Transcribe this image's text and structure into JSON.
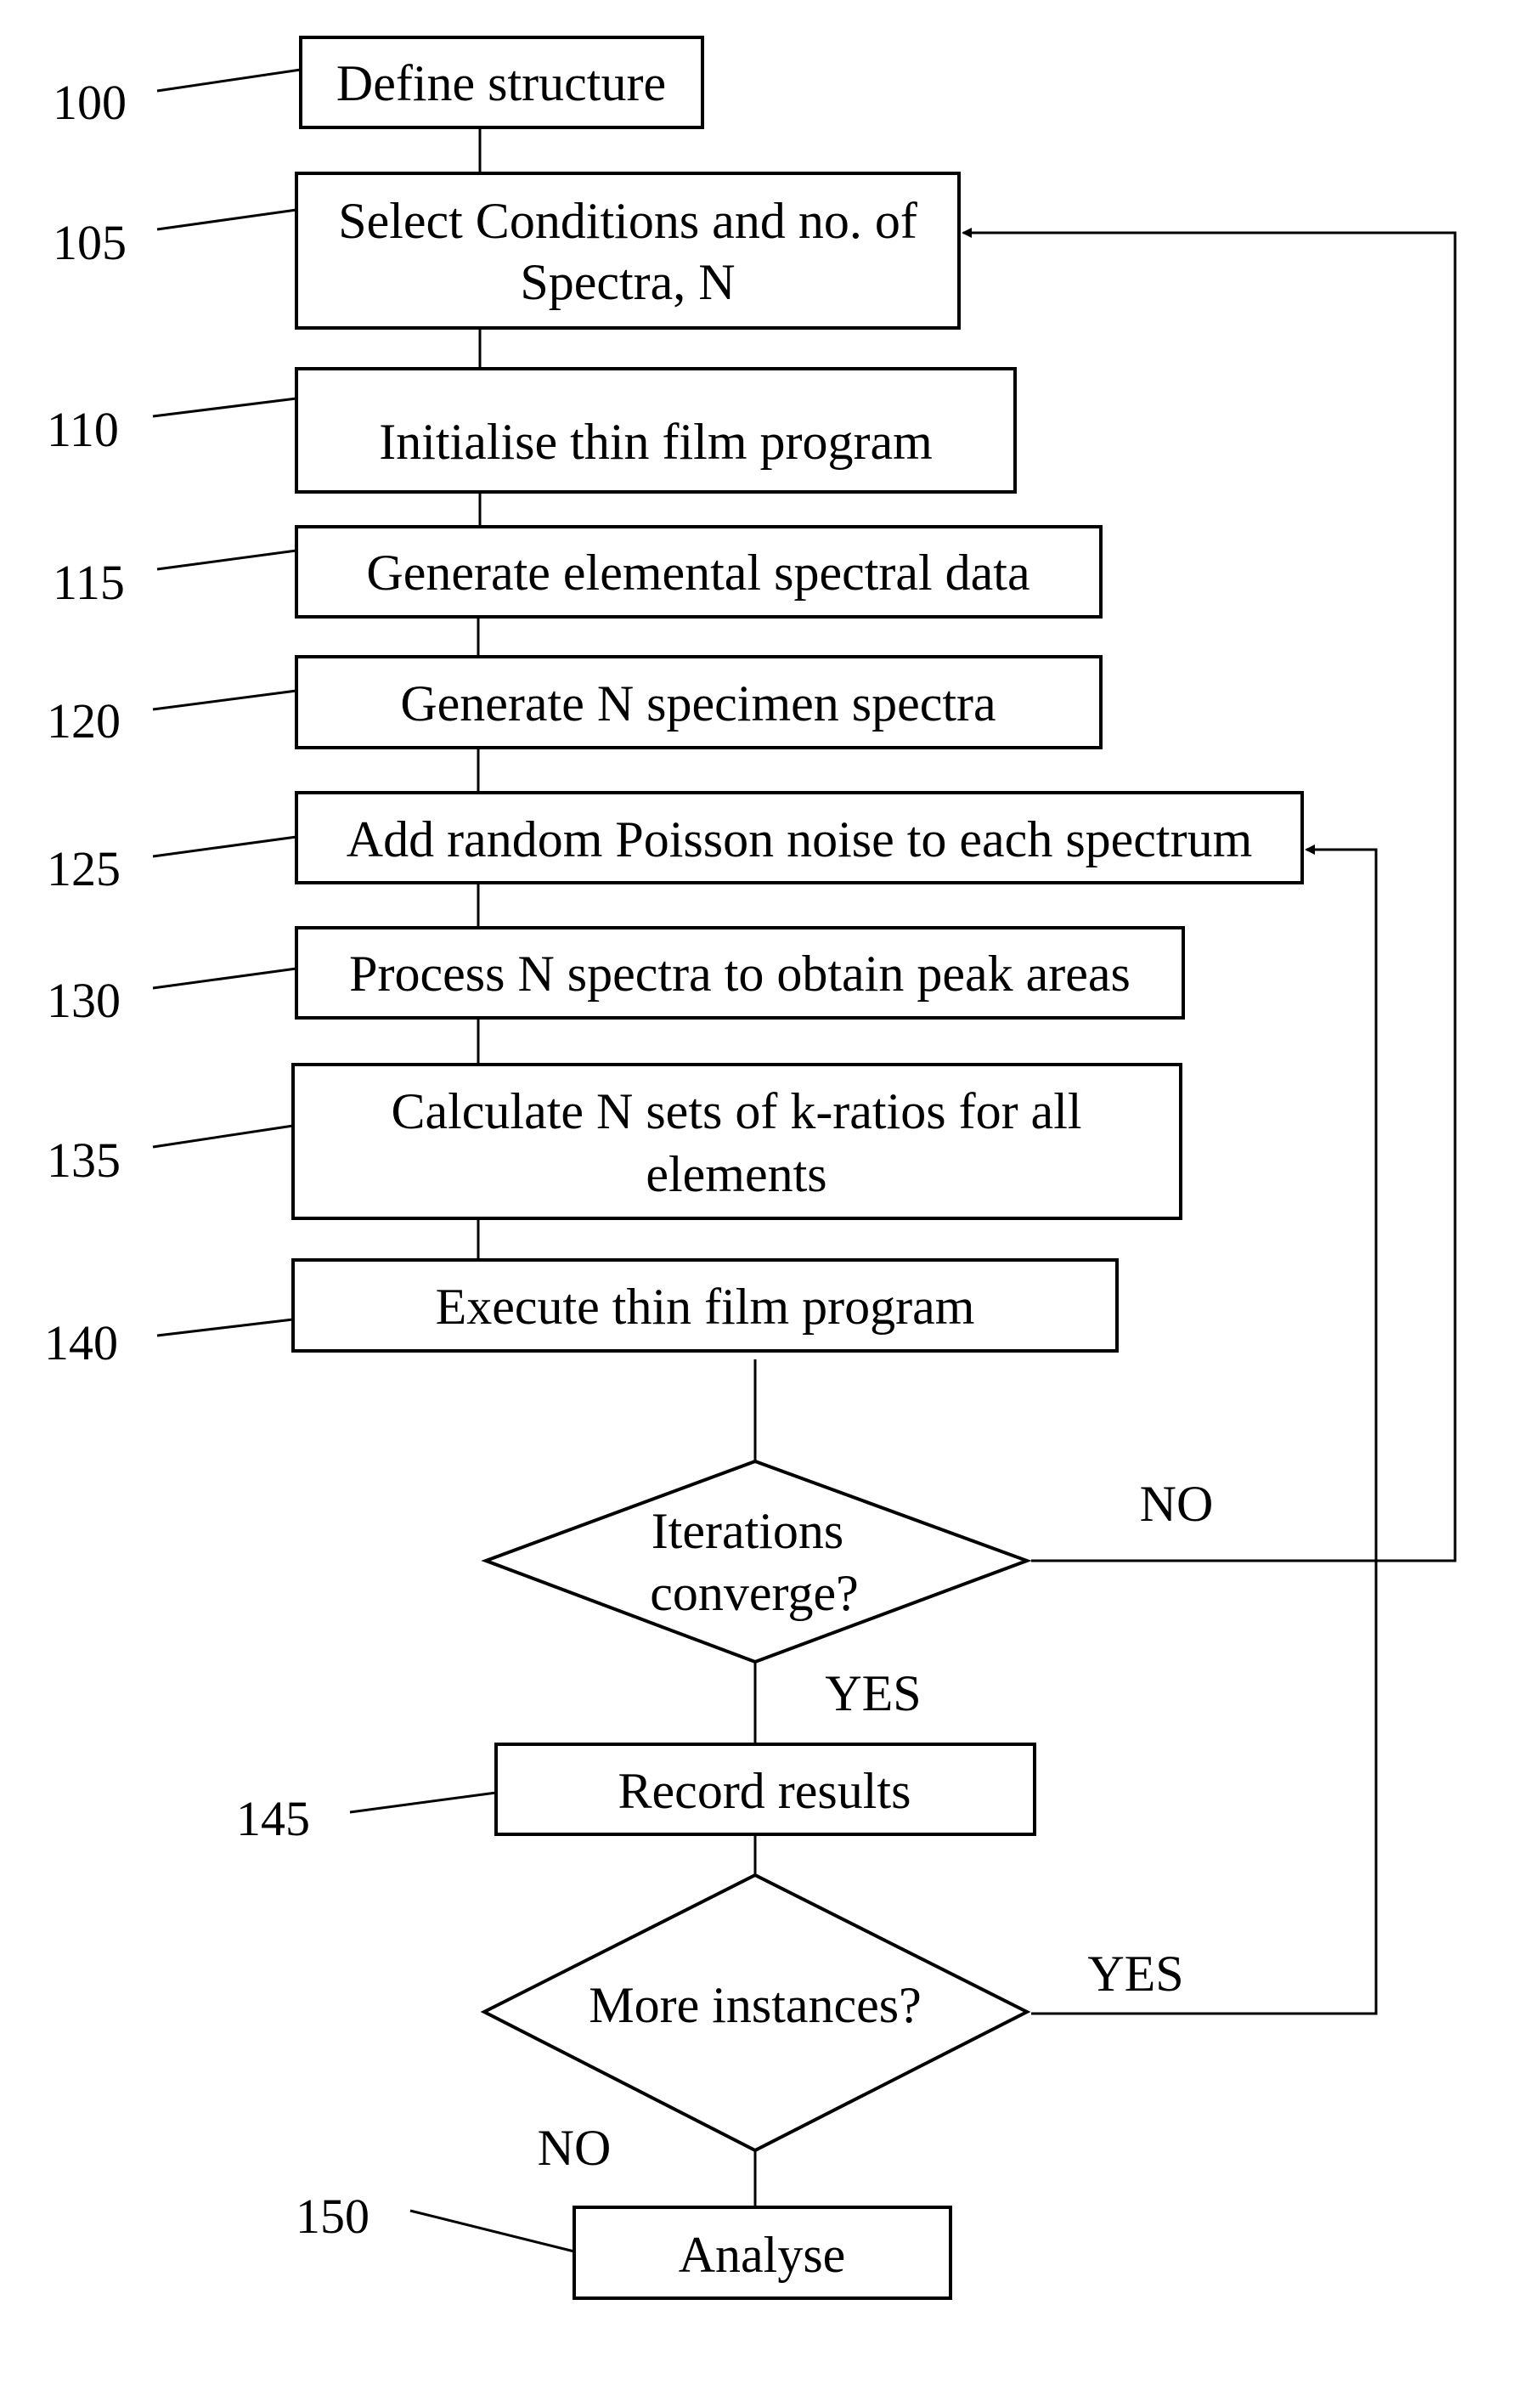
{
  "figure": {
    "type": "flowchart",
    "steps": [
      {
        "ref": "100",
        "lines": [
          "Define structure"
        ]
      },
      {
        "ref": "105",
        "lines": [
          "Select Conditions and no. of",
          "Spectra, N"
        ]
      },
      {
        "ref": "110",
        "lines": [
          "Initialise thin film program"
        ]
      },
      {
        "ref": "115",
        "lines": [
          "Generate elemental spectral data"
        ]
      },
      {
        "ref": "120",
        "lines": [
          "Generate N specimen spectra"
        ]
      },
      {
        "ref": "125",
        "lines": [
          "Add random Poisson noise to each spectrum"
        ]
      },
      {
        "ref": "130",
        "lines": [
          "Process N spectra  to obtain peak areas"
        ]
      },
      {
        "ref": "135",
        "lines": [
          "Calculate N sets of k-ratios for all",
          "elements"
        ]
      },
      {
        "ref": "140",
        "lines": [
          "Execute thin film program"
        ]
      },
      {
        "ref": "145",
        "lines": [
          "Record results"
        ]
      },
      {
        "ref": "150",
        "lines": [
          "Analyse"
        ]
      }
    ],
    "decisions": [
      {
        "lines": [
          "Iterations",
          "converge?"
        ],
        "yes_label": "YES",
        "no_label": "NO"
      },
      {
        "lines": [
          "More instances?"
        ],
        "yes_label": "YES",
        "no_label": "NO"
      }
    ]
  }
}
